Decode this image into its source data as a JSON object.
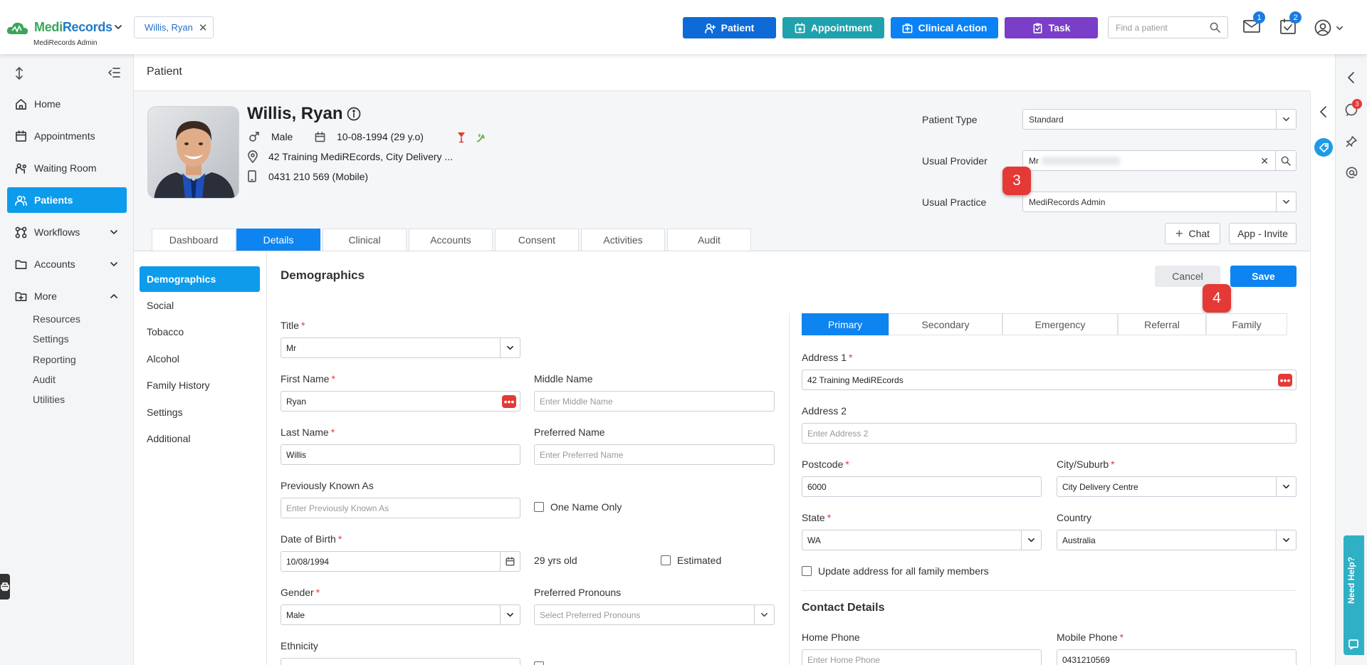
{
  "header": {
    "brand_a": "Medi",
    "brand_b": "Records",
    "brand_sub": "MediRecords Admin",
    "patient_chip": "Willis, Ryan",
    "buttons": {
      "patient": "Patient",
      "appointment": "Appointment",
      "clinical_action": "Clinical Action",
      "task": "Task"
    },
    "search_placeholder": "Find a patient",
    "mail_badge": "1",
    "tasks_badge": "2",
    "colors": {
      "patient": "#0d6ad6",
      "appointment": "#1fa2ad",
      "clinical_action": "#0a82f5",
      "task": "#7a3ec8"
    }
  },
  "sidebar": {
    "items": [
      {
        "label": "Home",
        "icon": "home-icon"
      },
      {
        "label": "Appointments",
        "icon": "calendar-icon"
      },
      {
        "label": "Waiting Room",
        "icon": "waiting-room-icon"
      },
      {
        "label": "Patients",
        "icon": "users-icon",
        "active": true
      },
      {
        "label": "Workflows",
        "icon": "workflow-icon"
      },
      {
        "label": "Accounts",
        "icon": "folder-icon"
      },
      {
        "label": "More",
        "icon": "folder-plus-icon"
      }
    ],
    "sub_items": [
      "Resources",
      "Settings",
      "Reporting",
      "Audit",
      "Utilities"
    ]
  },
  "page": {
    "title": "Patient"
  },
  "patient": {
    "name": "Willis, Ryan",
    "gender": "Male",
    "dob": "10-08-1994 (29 y.o)",
    "address": "42 Training MediREcords, City Delivery ...",
    "phone": "0431 210 569 (Mobile)",
    "patient_type_label": "Patient Type",
    "patient_type": "Standard",
    "usual_provider_label": "Usual Provider",
    "usual_provider": "Mr",
    "usual_practice_label": "Usual Practice",
    "usual_practice": "MediRecords Admin",
    "chat_label": "Chat",
    "app_invite_label": "App - Invite"
  },
  "markers": {
    "m3": "3",
    "m4": "4"
  },
  "tabs": [
    "Dashboard",
    "Details",
    "Clinical",
    "Accounts",
    "Consent",
    "Activities",
    "Audit"
  ],
  "details_nav": [
    "Demographics",
    "Social",
    "Tobacco",
    "Alcohol",
    "Family History",
    "Settings",
    "Additional"
  ],
  "form": {
    "section_title": "Demographics",
    "cancel": "Cancel",
    "save": "Save",
    "title_label": "Title",
    "title_value": "Mr",
    "first_name_label": "First Name",
    "first_name": "Ryan",
    "middle_name_label": "Middle Name",
    "middle_name_ph": "Enter Middle Name",
    "last_name_label": "Last Name",
    "last_name": "Willis",
    "preferred_name_label": "Preferred Name",
    "preferred_name_ph": "Enter Preferred Name",
    "prev_known_label": "Previously Known As",
    "prev_known_ph": "Enter Previously Known As",
    "one_name_only": "One Name Only",
    "dob_label": "Date of Birth",
    "dob": "10/08/1994",
    "age_text": "29 yrs old",
    "estimated": "Estimated",
    "gender_label": "Gender",
    "gender": "Male",
    "pronouns_label": "Preferred Pronouns",
    "pronouns_ph": "Select Preferred Pronouns",
    "ethnicity_label": "Ethnicity"
  },
  "address": {
    "tabs": [
      "Primary",
      "Secondary",
      "Emergency",
      "Referral",
      "Family"
    ],
    "address1_label": "Address 1",
    "address1": "42 Training MediREcords",
    "address2_label": "Address 2",
    "address2_ph": "Enter Address 2",
    "postcode_label": "Postcode",
    "postcode": "6000",
    "city_label": "City/Suburb",
    "city": "City Delivery Centre",
    "state_label": "State",
    "state": "WA",
    "country_label": "Country",
    "country": "Australia",
    "update_family": "Update address for all family members",
    "contact_title": "Contact Details",
    "home_phone_label": "Home Phone",
    "home_phone_ph": "Enter Home Phone",
    "mobile_phone_label": "Mobile Phone",
    "mobile_phone": "0431210569"
  },
  "rail": {
    "chat_badge": "3",
    "help_label": "Need Help?"
  }
}
